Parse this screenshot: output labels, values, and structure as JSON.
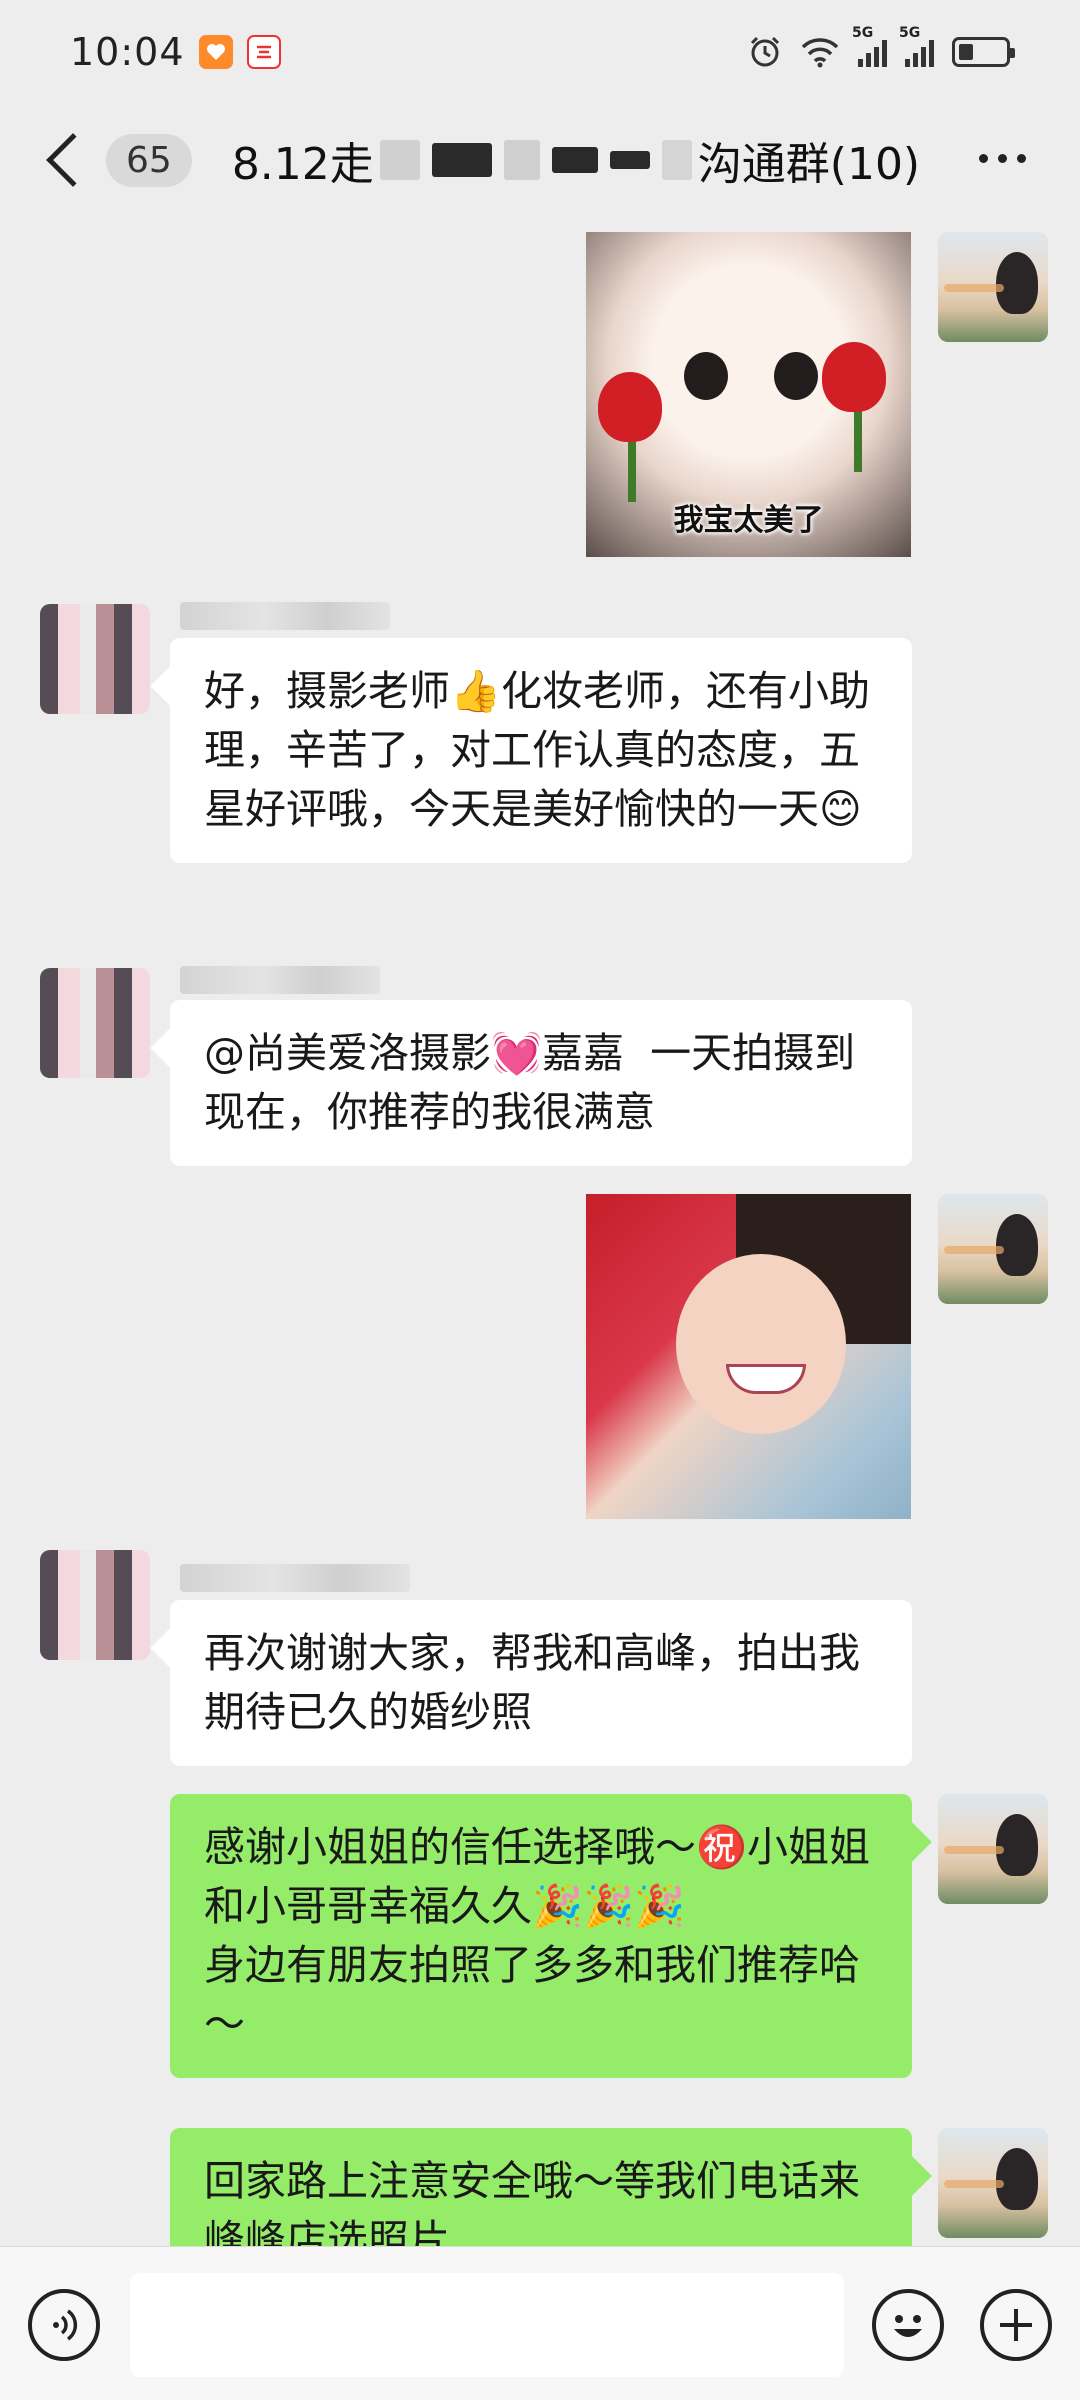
{
  "status_bar": {
    "time": "10:04",
    "network_1": "5G",
    "network_2": "5G"
  },
  "header": {
    "unread_count": "65",
    "title_prefix": "8.12走",
    "title_suffix": "沟通群(10)"
  },
  "messages": [
    {
      "id": "m1",
      "side": "right",
      "type": "sticker",
      "caption": "我宝太美了"
    },
    {
      "id": "m2",
      "side": "left",
      "type": "text",
      "text": "好，摄影老师👍化妆老师，还有小助理，辛苦了，对工作认真的态度，五星好评哦，今天是美好愉快的一天😊"
    },
    {
      "id": "m3",
      "side": "left",
      "type": "text",
      "text": "@尚美爱洛摄影💓嘉嘉  一天拍摄到现在，你推荐的我很满意"
    },
    {
      "id": "m4",
      "side": "right",
      "type": "sticker",
      "caption": ""
    },
    {
      "id": "m5",
      "side": "left",
      "type": "text",
      "text": "再次谢谢大家，帮我和高峰，拍出我期待已久的婚纱照"
    },
    {
      "id": "m6",
      "side": "right",
      "type": "text",
      "text": "感谢小姐姐的信任选择哦～㊗️小姐姐和小哥哥幸福久久🎉🎉🎉\n身边有朋友拍照了多多和我们推荐哈～"
    },
    {
      "id": "m7",
      "side": "right",
      "type": "text",
      "text": "回家路上注意安全哦～等我们电话来峰峰店选照片"
    }
  ],
  "input_bar": {
    "voice_icon": "voice-icon",
    "emoji_icon": "emoji-icon",
    "plus_icon": "plus-icon",
    "input_value": ""
  },
  "colors": {
    "background": "#ededed",
    "self_bubble": "#95ec69",
    "other_bubble": "#ffffff"
  }
}
